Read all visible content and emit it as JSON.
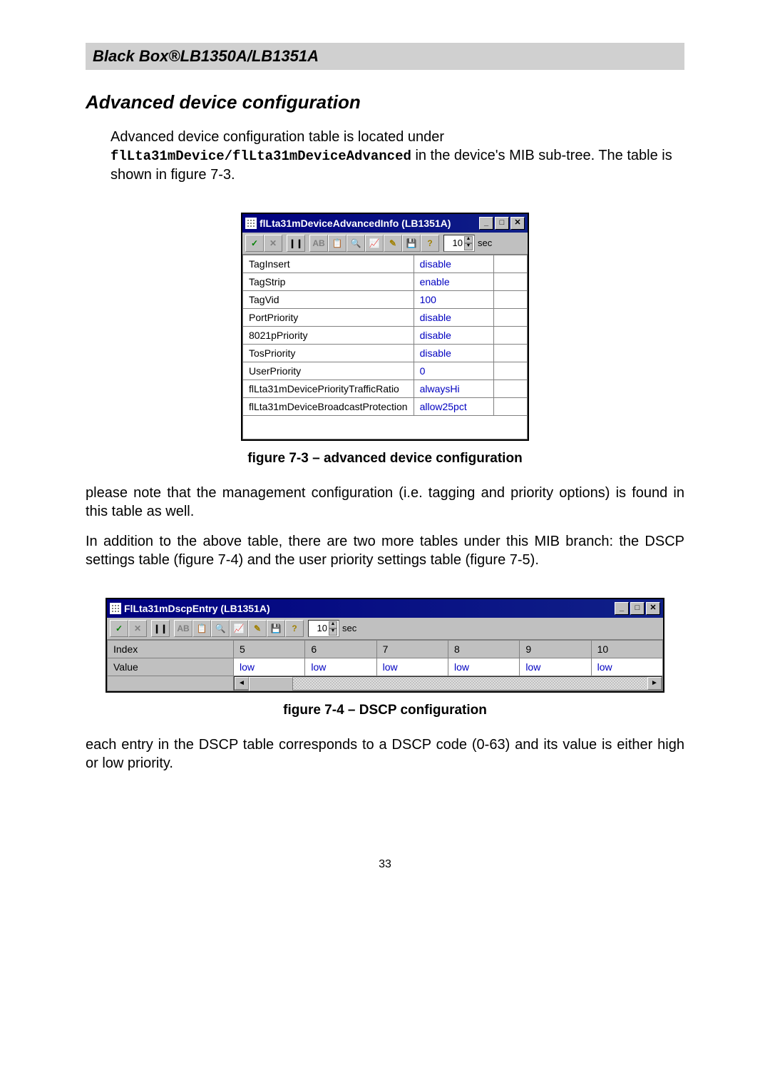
{
  "header": "Black Box®LB1350A/LB1351A",
  "section_title": "Advanced device configuration",
  "intro": {
    "pre": "Advanced device configuration table is located under ",
    "mib_path": "flLta31mDevice/flLta31mDeviceAdvanced",
    "post": " in the device's MIB sub-tree. The table is shown in figure 7-3."
  },
  "win1": {
    "title": "flLta31mDeviceAdvancedInfo (LB1351A)",
    "spin_value": "10",
    "spin_unit": "sec",
    "rows": [
      {
        "name": "TagInsert",
        "value": "disable"
      },
      {
        "name": "TagStrip",
        "value": "enable"
      },
      {
        "name": "TagVid",
        "value": "100"
      },
      {
        "name": "PortPriority",
        "value": "disable"
      },
      {
        "name": "8021pPriority",
        "value": "disable"
      },
      {
        "name": "TosPriority",
        "value": "disable"
      },
      {
        "name": "UserPriority",
        "value": "0"
      },
      {
        "name": "flLta31mDevicePriorityTrafficRatio",
        "value": "alwaysHi"
      },
      {
        "name": "flLta31mDeviceBroadcastProtection",
        "value": "allow25pct"
      }
    ]
  },
  "caption1": "figure 7-3 – advanced device configuration",
  "para1": "please note that the management configuration (i.e. tagging and priority options) is found in this table as well.",
  "para2": "In addition to the above table, there are two more tables under this MIB branch: the DSCP settings table (figure 7-4) and the user priority settings table (figure 7-5).",
  "win2": {
    "title": "FlLta31mDscpEntry (LB1351A)",
    "spin_value": "10",
    "spin_unit": "sec",
    "index_label": "Index",
    "value_label": "Value",
    "columns": [
      "5",
      "6",
      "7",
      "8",
      "9",
      "10"
    ],
    "values": [
      "low",
      "low",
      "low",
      "low",
      "low",
      "low"
    ]
  },
  "caption2": "figure 7-4 – DSCP configuration",
  "para3": "each entry in the DSCP table corresponds to a DSCP code (0-63) and its value is either high or low priority.",
  "page_number": "33",
  "icons": {
    "check": "✓",
    "x": "✕",
    "pause": "❙❙",
    "ab": "AB",
    "clipboard": "📋",
    "find": "🔍",
    "chart": "📈",
    "wand": "✎",
    "save": "💾",
    "help": "?"
  },
  "toolbar_order": [
    "check",
    "x",
    "pause",
    "ab",
    "clipboard",
    "find",
    "chart",
    "wand",
    "save",
    "help"
  ]
}
